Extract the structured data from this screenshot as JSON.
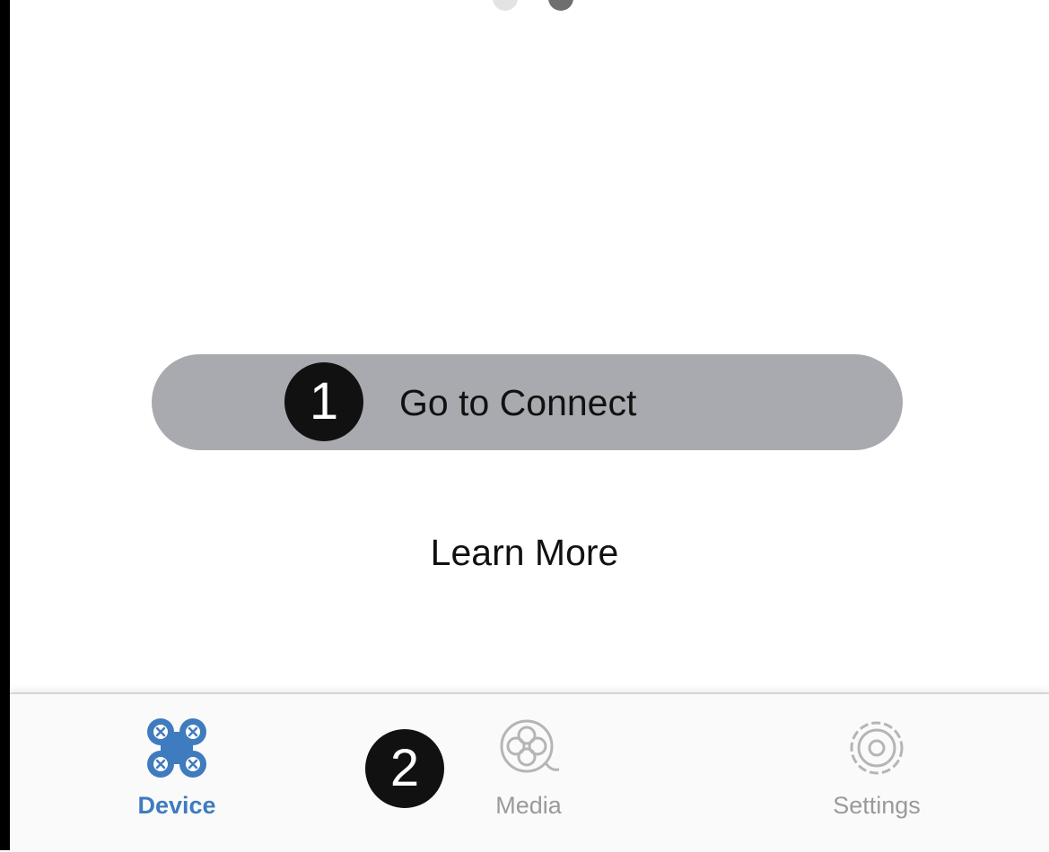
{
  "main": {
    "connect_button_label": "Go to Connect",
    "learn_more_label": "Learn More"
  },
  "annotations": {
    "marker_1": "1",
    "marker_2": "2"
  },
  "tab_bar": {
    "tabs": [
      {
        "label": "Device",
        "icon": "drone-icon",
        "active": true
      },
      {
        "label": "Media",
        "icon": "media-reel-icon",
        "active": false
      },
      {
        "label": "Settings",
        "icon": "gear-icon",
        "active": false
      }
    ]
  },
  "colors": {
    "accent": "#3f7bbf",
    "button": "#a9aaaf",
    "inactive_tab": "#9a9a9a"
  }
}
